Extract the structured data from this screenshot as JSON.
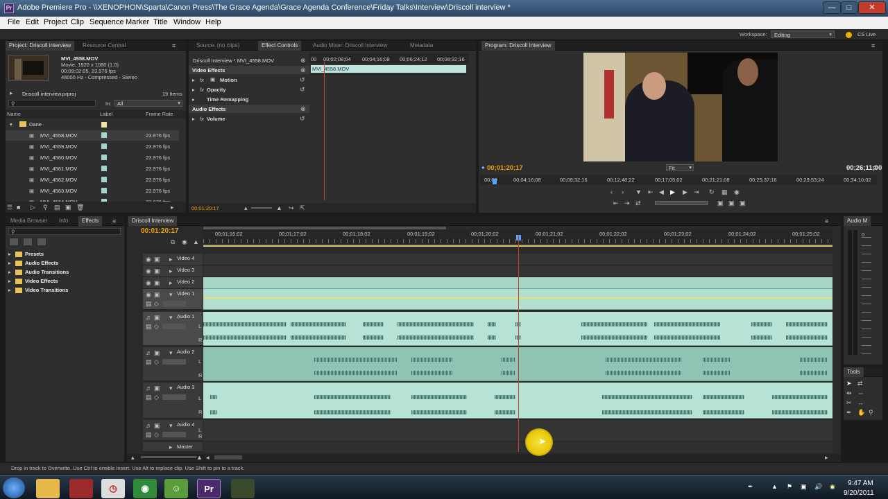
{
  "titlebar": {
    "title": "Adobe Premiere Pro - \\\\XENOPHON\\Sparta\\Canon Press\\The Grace Agenda\\Grace Agenda Conference\\Friday Talks\\Interview\\Driscoll interview *",
    "app_icon": "Pr"
  },
  "menu": [
    "File",
    "Edit",
    "Project",
    "Clip",
    "Sequence",
    "Marker",
    "Title",
    "Window",
    "Help"
  ],
  "workspace": {
    "label": "Workspace:",
    "value": "Editing",
    "cs_live": "CS Live"
  },
  "project_panel": {
    "tabs": [
      "Project: Driscoll interview",
      "Resource Central"
    ],
    "clip_name": "MVI_4558.MOV",
    "clip_info": [
      "Movie, 1920 x 1080 (1.0)",
      "00:09:02:05, 23.976 fps",
      "48000 Hz - Compressed - Stereo"
    ],
    "project_file": "Driscoll interview.prproj",
    "items_count": "19 Items",
    "in_label": "In:",
    "in_value": "All",
    "columns": [
      "Name",
      "Label",
      "Frame Rate"
    ],
    "folder": "Dane",
    "rows": [
      {
        "name": "MVI_4558.MOV",
        "rate": "23.976 fps"
      },
      {
        "name": "MVI_4559.MOV",
        "rate": "23.976 fps"
      },
      {
        "name": "MVI_4560.MOV",
        "rate": "23.976 fps"
      },
      {
        "name": "MVI_4561.MOV",
        "rate": "23.976 fps"
      },
      {
        "name": "MVI_4562.MOV",
        "rate": "23.976 fps"
      },
      {
        "name": "MVI_4563.MOV",
        "rate": "23.976 fps"
      },
      {
        "name": "MVI_4564.MOV",
        "rate": "23.976 fps"
      }
    ]
  },
  "effect_controls": {
    "tabs": [
      "Source: (no clips)",
      "Effect Controls",
      "Audio Mixer: Driscoll Interview",
      "Metadata"
    ],
    "sequence_label": "Driscoll Interview * MVI_4558.MOV",
    "ruler": [
      "00",
      "00;02;08;04",
      "00;04;16;08",
      "00;06;24;12",
      "00;08;32;16"
    ],
    "clip_name": "MVI_4558.MOV",
    "video_effects": "Video Effects",
    "items": [
      "Motion",
      "Opacity",
      "Time Remapping"
    ],
    "audio_effects": "Audio Effects",
    "volume": "Volume",
    "timecode": "00:01:20:17"
  },
  "program_monitor": {
    "tab": "Program: Driscoll Interview",
    "current_time": "00;01;20;17",
    "fit": "Fit",
    "duration": "00;26;11;00",
    "ruler": [
      "00;00",
      "00;04;16;08",
      "00;08;32;16",
      "00;12;48;22",
      "00;17;05;02",
      "00;21;21;08",
      "00;25;37;16",
      "00;29;53;24",
      "00;34;10;02"
    ]
  },
  "effects_panel": {
    "tabs": [
      "Media Browser",
      "Info",
      "Effects"
    ],
    "folders": [
      "Presets",
      "Audio Effects",
      "Audio Transitions",
      "Video Effects",
      "Video Transitions"
    ]
  },
  "timeline": {
    "tab": "Driscoll Interview",
    "timecode": "00:01:20:17",
    "ruler": [
      "00;01;16;02",
      "00;01;17;02",
      "00;01;18;02",
      "00;01;19;02",
      "00;01;20;02",
      "00;01;21;02",
      "00;01;22;02",
      "00;01;23;02",
      "00;01;24;02",
      "00;01;25;02"
    ],
    "video_tracks": [
      "Video 4",
      "Video 3",
      "Video 2",
      "Video 1"
    ],
    "audio_tracks": [
      "Audio 1",
      "Audio 2",
      "Audio 3",
      "Audio 4"
    ],
    "master": "Master",
    "channel_l": "L",
    "channel_r": "R"
  },
  "audio_meter": {
    "tab": "Audio M",
    "zero": "0"
  },
  "tools": {
    "tab": "Tools"
  },
  "status_bar": "Drop in track to Overwrite. Use Ctrl to enable Insert. Use Alt to replace clip. Use Shift to pin to a track.",
  "taskbar": {
    "time": "9:47 AM",
    "date": "9/20/2011",
    "premiere_label": "Pr"
  },
  "colors": {
    "clip_teal": "#a6d6c7",
    "timecode_orange": "#f0a500",
    "playhead_red": "#d23b2b",
    "titlebar_blue": "#3b5a7c"
  }
}
